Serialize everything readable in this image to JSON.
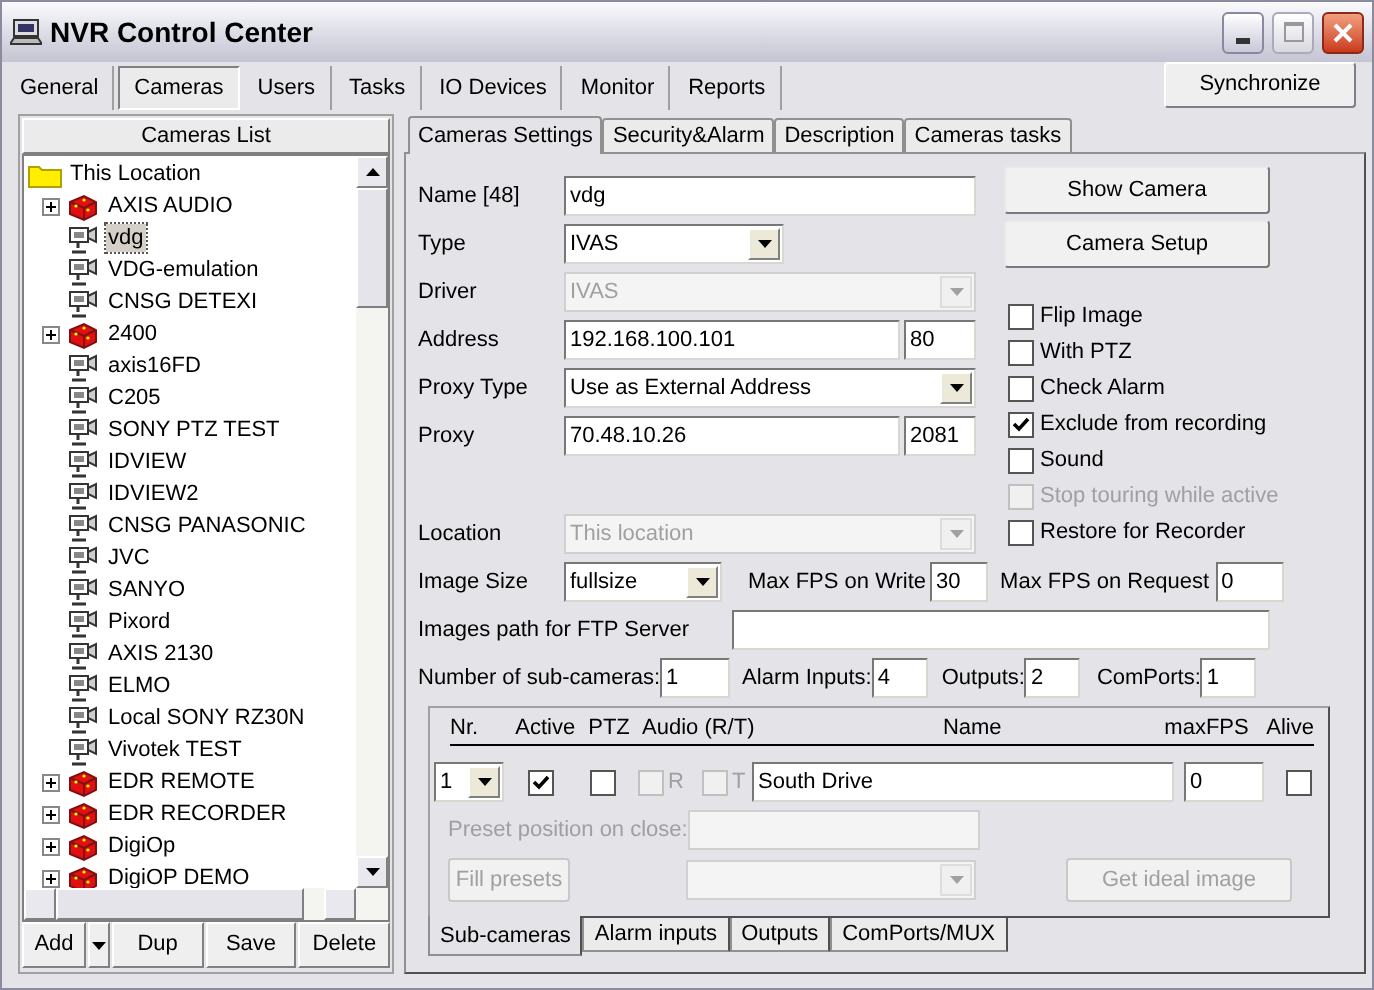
{
  "window": {
    "title": "NVR Control Center"
  },
  "main_tabs": [
    {
      "label": "General",
      "selected": false
    },
    {
      "label": "Cameras",
      "selected": true
    },
    {
      "label": "Users",
      "selected": false
    },
    {
      "label": "Tasks",
      "selected": false
    },
    {
      "label": "IO Devices",
      "selected": false
    },
    {
      "label": "Monitor",
      "selected": false
    },
    {
      "label": "Reports",
      "selected": false
    }
  ],
  "sync_button": "Synchronize",
  "cameras_list": {
    "title": "Cameras List",
    "tree": [
      {
        "label": "This Location",
        "kind": "folder",
        "children": [
          {
            "label": "AXIS AUDIO",
            "kind": "recorder",
            "expanded": false,
            "selected": false
          },
          {
            "label": "vdg",
            "kind": "camera",
            "selected": true
          },
          {
            "label": "VDG-emulation",
            "kind": "camera",
            "selected": false
          },
          {
            "label": "CNSG DETEXI",
            "kind": "camera",
            "selected": false
          },
          {
            "label": "2400",
            "kind": "recorder",
            "expanded": false,
            "selected": false
          },
          {
            "label": "axis16FD",
            "kind": "camera",
            "selected": false
          },
          {
            "label": "C205",
            "kind": "camera",
            "selected": false
          },
          {
            "label": "SONY PTZ TEST",
            "kind": "camera",
            "selected": false
          },
          {
            "label": "IDVIEW",
            "kind": "camera",
            "selected": false
          },
          {
            "label": "IDVIEW2",
            "kind": "camera",
            "selected": false
          },
          {
            "label": "CNSG PANASONIC",
            "kind": "camera",
            "selected": false
          },
          {
            "label": "JVC",
            "kind": "camera",
            "selected": false
          },
          {
            "label": "SANYO",
            "kind": "camera",
            "selected": false
          },
          {
            "label": "Pixord",
            "kind": "camera",
            "selected": false
          },
          {
            "label": "AXIS 2130",
            "kind": "camera",
            "selected": false
          },
          {
            "label": "ELMO",
            "kind": "camera",
            "selected": false
          },
          {
            "label": "Local SONY RZ30N",
            "kind": "camera",
            "selected": false
          },
          {
            "label": "Vivotek TEST",
            "kind": "camera",
            "selected": false
          },
          {
            "label": "EDR REMOTE",
            "kind": "recorder",
            "expanded": false,
            "selected": false
          },
          {
            "label": "EDR RECORDER",
            "kind": "recorder",
            "expanded": false,
            "selected": false
          },
          {
            "label": "DigiOp",
            "kind": "recorder",
            "expanded": false,
            "selected": false
          },
          {
            "label": "DigiOP DEMO",
            "kind": "recorder",
            "expanded": false,
            "selected": false
          }
        ]
      }
    ]
  },
  "list_buttons": [
    {
      "label": "Add",
      "kind": "split"
    },
    {
      "label": "Dup",
      "kind": "plain"
    },
    {
      "label": "Save",
      "kind": "plain"
    },
    {
      "label": "Delete",
      "kind": "plain"
    }
  ],
  "settings_tabs": [
    {
      "label": "Cameras Settings",
      "selected": true
    },
    {
      "label": "Security&Alarm",
      "selected": false
    },
    {
      "label": "Description",
      "selected": false
    },
    {
      "label": "Cameras tasks",
      "selected": false
    }
  ],
  "form": {
    "name": {
      "label": "Name [48]",
      "value": "vdg"
    },
    "type": {
      "label": "Type",
      "value": "IVAS"
    },
    "driver": {
      "label": "Driver",
      "value": "IVAS",
      "disabled": true
    },
    "address": {
      "label": "Address",
      "value": "192.168.100.101",
      "port": "80"
    },
    "proxy_type": {
      "label": "Proxy Type",
      "value": "Use as External Address"
    },
    "proxy": {
      "label": "Proxy",
      "value": "70.48.10.26",
      "port": "2081"
    },
    "location": {
      "label": "Location",
      "value": "This location",
      "disabled": true
    },
    "image_size": {
      "label": "Image Size",
      "value": "fullsize"
    },
    "max_fps_write": {
      "label": "Max FPS on Write",
      "value": "30"
    },
    "max_fps_request": {
      "label": "Max FPS on Request",
      "value": "0"
    },
    "ftp_path": {
      "label": "Images path for FTP Server"
    },
    "sub_cameras_count": {
      "label": "Number of sub-cameras:",
      "value": "1"
    },
    "alarm_inputs": {
      "label": "Alarm Inputs:",
      "value": "4"
    },
    "outputs": {
      "label": "Outputs:",
      "value": "2"
    },
    "com_ports": {
      "label": "ComPorts:",
      "value": "1"
    }
  },
  "action_buttons": [
    "Show Camera",
    "Camera Setup"
  ],
  "options": [
    {
      "label": "Flip Image",
      "checked": false,
      "disabled": false
    },
    {
      "label": "With PTZ",
      "checked": false,
      "disabled": false
    },
    {
      "label": "Check Alarm",
      "checked": false,
      "disabled": false
    },
    {
      "label": "Exclude from recording",
      "checked": true,
      "disabled": false
    },
    {
      "label": "Sound",
      "checked": false,
      "disabled": false
    },
    {
      "label": "Stop touring while active",
      "checked": false,
      "disabled": true
    },
    {
      "label": "Restore for Recorder",
      "checked": false,
      "disabled": false
    }
  ],
  "sub_cameras": {
    "columns": [
      "Nr.",
      "Active",
      "PTZ",
      "Audio (R/T)",
      "Name",
      "maxFPS",
      "Alive"
    ],
    "row": {
      "nr": "1",
      "active": true,
      "ptz": false,
      "audio_disabled": true,
      "audio_r_label": "R",
      "audio_r": false,
      "audio_t_label": "T",
      "audio_t": false,
      "name": "South Drive",
      "max_fps": "0",
      "alive": false
    },
    "preset": {
      "label": "Preset position on close:",
      "disabled": true
    },
    "fill_presets": {
      "label": "Fill presets",
      "disabled": true
    },
    "preset_combo": {
      "disabled": true
    },
    "ideal_image": {
      "label": "Get ideal image",
      "disabled": true
    },
    "tabs": [
      {
        "label": "Sub-cameras",
        "selected": true
      },
      {
        "label": "Alarm inputs",
        "selected": false
      },
      {
        "label": "Outputs",
        "selected": false
      },
      {
        "label": "ComPorts/MUX",
        "selected": false
      }
    ]
  }
}
